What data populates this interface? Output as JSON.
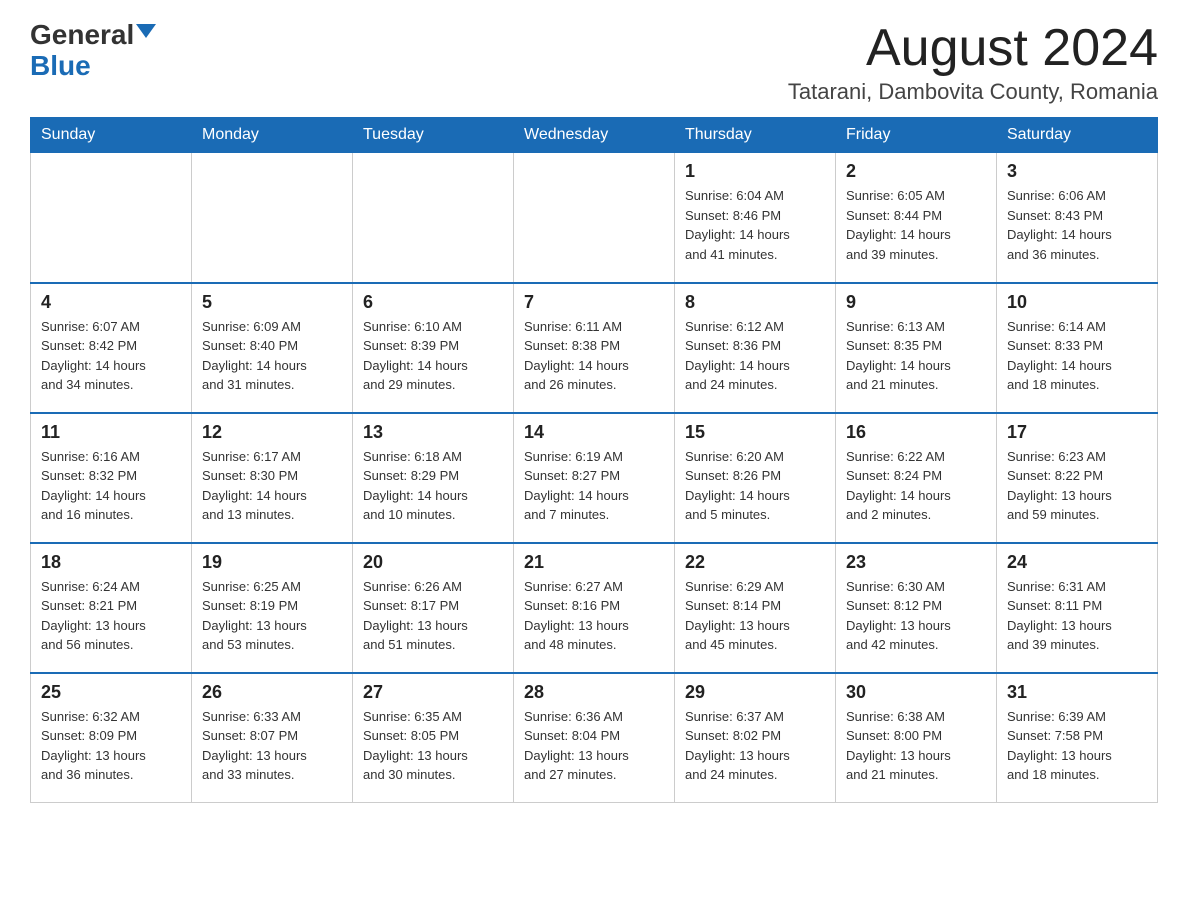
{
  "logo": {
    "general": "General",
    "blue": "Blue"
  },
  "title": "August 2024",
  "location": "Tatarani, Dambovita County, Romania",
  "days_of_week": [
    "Sunday",
    "Monday",
    "Tuesday",
    "Wednesday",
    "Thursday",
    "Friday",
    "Saturday"
  ],
  "weeks": [
    [
      {
        "day": "",
        "info": ""
      },
      {
        "day": "",
        "info": ""
      },
      {
        "day": "",
        "info": ""
      },
      {
        "day": "",
        "info": ""
      },
      {
        "day": "1",
        "info": "Sunrise: 6:04 AM\nSunset: 8:46 PM\nDaylight: 14 hours\nand 41 minutes."
      },
      {
        "day": "2",
        "info": "Sunrise: 6:05 AM\nSunset: 8:44 PM\nDaylight: 14 hours\nand 39 minutes."
      },
      {
        "day": "3",
        "info": "Sunrise: 6:06 AM\nSunset: 8:43 PM\nDaylight: 14 hours\nand 36 minutes."
      }
    ],
    [
      {
        "day": "4",
        "info": "Sunrise: 6:07 AM\nSunset: 8:42 PM\nDaylight: 14 hours\nand 34 minutes."
      },
      {
        "day": "5",
        "info": "Sunrise: 6:09 AM\nSunset: 8:40 PM\nDaylight: 14 hours\nand 31 minutes."
      },
      {
        "day": "6",
        "info": "Sunrise: 6:10 AM\nSunset: 8:39 PM\nDaylight: 14 hours\nand 29 minutes."
      },
      {
        "day": "7",
        "info": "Sunrise: 6:11 AM\nSunset: 8:38 PM\nDaylight: 14 hours\nand 26 minutes."
      },
      {
        "day": "8",
        "info": "Sunrise: 6:12 AM\nSunset: 8:36 PM\nDaylight: 14 hours\nand 24 minutes."
      },
      {
        "day": "9",
        "info": "Sunrise: 6:13 AM\nSunset: 8:35 PM\nDaylight: 14 hours\nand 21 minutes."
      },
      {
        "day": "10",
        "info": "Sunrise: 6:14 AM\nSunset: 8:33 PM\nDaylight: 14 hours\nand 18 minutes."
      }
    ],
    [
      {
        "day": "11",
        "info": "Sunrise: 6:16 AM\nSunset: 8:32 PM\nDaylight: 14 hours\nand 16 minutes."
      },
      {
        "day": "12",
        "info": "Sunrise: 6:17 AM\nSunset: 8:30 PM\nDaylight: 14 hours\nand 13 minutes."
      },
      {
        "day": "13",
        "info": "Sunrise: 6:18 AM\nSunset: 8:29 PM\nDaylight: 14 hours\nand 10 minutes."
      },
      {
        "day": "14",
        "info": "Sunrise: 6:19 AM\nSunset: 8:27 PM\nDaylight: 14 hours\nand 7 minutes."
      },
      {
        "day": "15",
        "info": "Sunrise: 6:20 AM\nSunset: 8:26 PM\nDaylight: 14 hours\nand 5 minutes."
      },
      {
        "day": "16",
        "info": "Sunrise: 6:22 AM\nSunset: 8:24 PM\nDaylight: 14 hours\nand 2 minutes."
      },
      {
        "day": "17",
        "info": "Sunrise: 6:23 AM\nSunset: 8:22 PM\nDaylight: 13 hours\nand 59 minutes."
      }
    ],
    [
      {
        "day": "18",
        "info": "Sunrise: 6:24 AM\nSunset: 8:21 PM\nDaylight: 13 hours\nand 56 minutes."
      },
      {
        "day": "19",
        "info": "Sunrise: 6:25 AM\nSunset: 8:19 PM\nDaylight: 13 hours\nand 53 minutes."
      },
      {
        "day": "20",
        "info": "Sunrise: 6:26 AM\nSunset: 8:17 PM\nDaylight: 13 hours\nand 51 minutes."
      },
      {
        "day": "21",
        "info": "Sunrise: 6:27 AM\nSunset: 8:16 PM\nDaylight: 13 hours\nand 48 minutes."
      },
      {
        "day": "22",
        "info": "Sunrise: 6:29 AM\nSunset: 8:14 PM\nDaylight: 13 hours\nand 45 minutes."
      },
      {
        "day": "23",
        "info": "Sunrise: 6:30 AM\nSunset: 8:12 PM\nDaylight: 13 hours\nand 42 minutes."
      },
      {
        "day": "24",
        "info": "Sunrise: 6:31 AM\nSunset: 8:11 PM\nDaylight: 13 hours\nand 39 minutes."
      }
    ],
    [
      {
        "day": "25",
        "info": "Sunrise: 6:32 AM\nSunset: 8:09 PM\nDaylight: 13 hours\nand 36 minutes."
      },
      {
        "day": "26",
        "info": "Sunrise: 6:33 AM\nSunset: 8:07 PM\nDaylight: 13 hours\nand 33 minutes."
      },
      {
        "day": "27",
        "info": "Sunrise: 6:35 AM\nSunset: 8:05 PM\nDaylight: 13 hours\nand 30 minutes."
      },
      {
        "day": "28",
        "info": "Sunrise: 6:36 AM\nSunset: 8:04 PM\nDaylight: 13 hours\nand 27 minutes."
      },
      {
        "day": "29",
        "info": "Sunrise: 6:37 AM\nSunset: 8:02 PM\nDaylight: 13 hours\nand 24 minutes."
      },
      {
        "day": "30",
        "info": "Sunrise: 6:38 AM\nSunset: 8:00 PM\nDaylight: 13 hours\nand 21 minutes."
      },
      {
        "day": "31",
        "info": "Sunrise: 6:39 AM\nSunset: 7:58 PM\nDaylight: 13 hours\nand 18 minutes."
      }
    ]
  ]
}
